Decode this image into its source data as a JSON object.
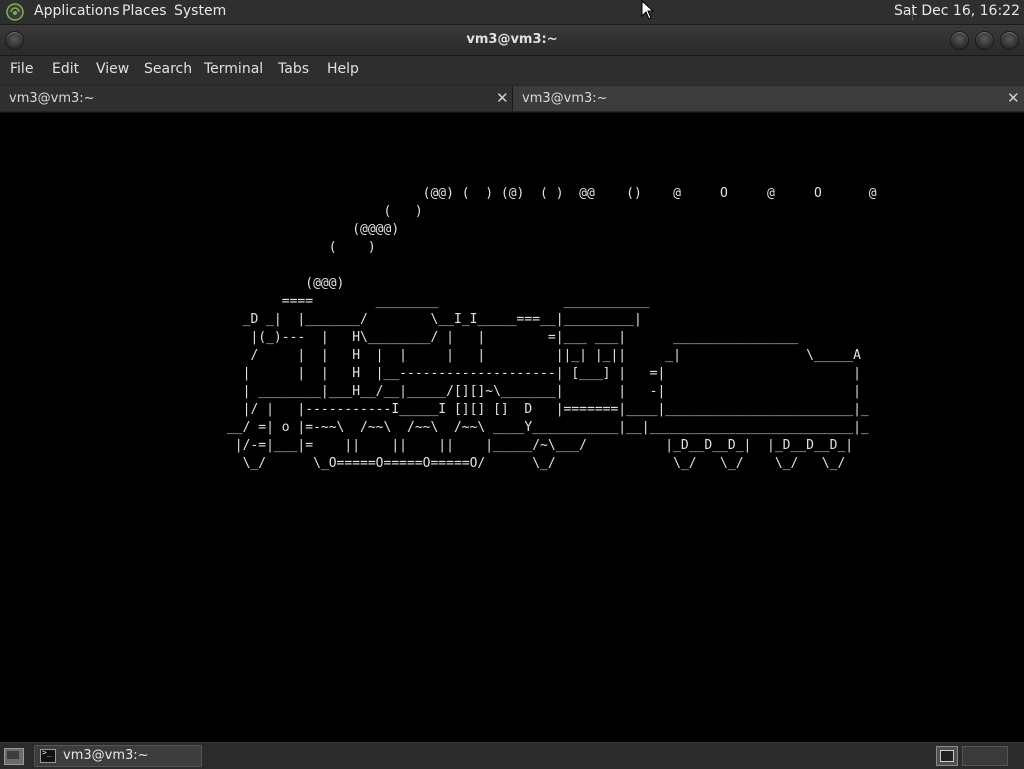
{
  "top_panel": {
    "menus": [
      "Applications",
      "Places",
      "System"
    ],
    "clock": "Sat Dec 16, 16:22"
  },
  "window": {
    "title": "vm3@vm3:~"
  },
  "menubar": {
    "items": [
      "File",
      "Edit",
      "View",
      "Search",
      "Terminal",
      "Tabs",
      "Help"
    ]
  },
  "tabs": [
    {
      "label": "vm3@vm3:~",
      "active": false
    },
    {
      "label": "vm3@vm3:~",
      "active": true
    }
  ],
  "terminal": {
    "art": "\n\n\n\n                                                      (@@) (  ) (@)  ( )  @@    ()    @     O     @     O      @\n                                                 (   )\n                                             (@@@@)\n                                          (    )\n\n                                       (@@@)\n                                    ====        ________                ___________\n                               _D _|  |_______/        \\__I_I_____===__|_________|\n                                |(_)---  |   H\\________/ |   |        =|___ ___|      ________________\n                                /     |  |   H  |  |     |   |         ||_| |_||     _|                \\_____A\n                               |      |  |   H  |__--------------------| [___] |   =|                        |\n                               | ________|___H__/__|_____/[][]~\\_______|       |   -|                        |\n                               |/ |   |-----------I_____I [][] []  D   |=======|____|________________________|_\n                             __/ =| o |=-~~\\  /~~\\  /~~\\  /~~\\ ____Y___________|__|__________________________|_\n                              |/-=|___|=    ||    ||    ||    |_____/~\\___/          |_D__D__D_|  |_D__D__D_|\n                               \\_/      \\_O=====O=====O=====O/      \\_/               \\_/   \\_/    \\_/   \\_/"
  },
  "bottom_panel": {
    "task_label": "vm3@vm3:~"
  },
  "colors": {
    "panel_bg": "#2f2f2f",
    "terminal_bg": "#000000",
    "terminal_fg": "#e2e2e2",
    "logo_accent": "#7ab648"
  },
  "icons": [
    "app-logo-icon",
    "window-menu-icon",
    "minimize-icon",
    "maximize-icon",
    "close-icon",
    "tab-close-icon",
    "show-desktop-icon",
    "terminal-icon",
    "workspace-switcher-icon",
    "mouse-pointer-icon"
  ]
}
